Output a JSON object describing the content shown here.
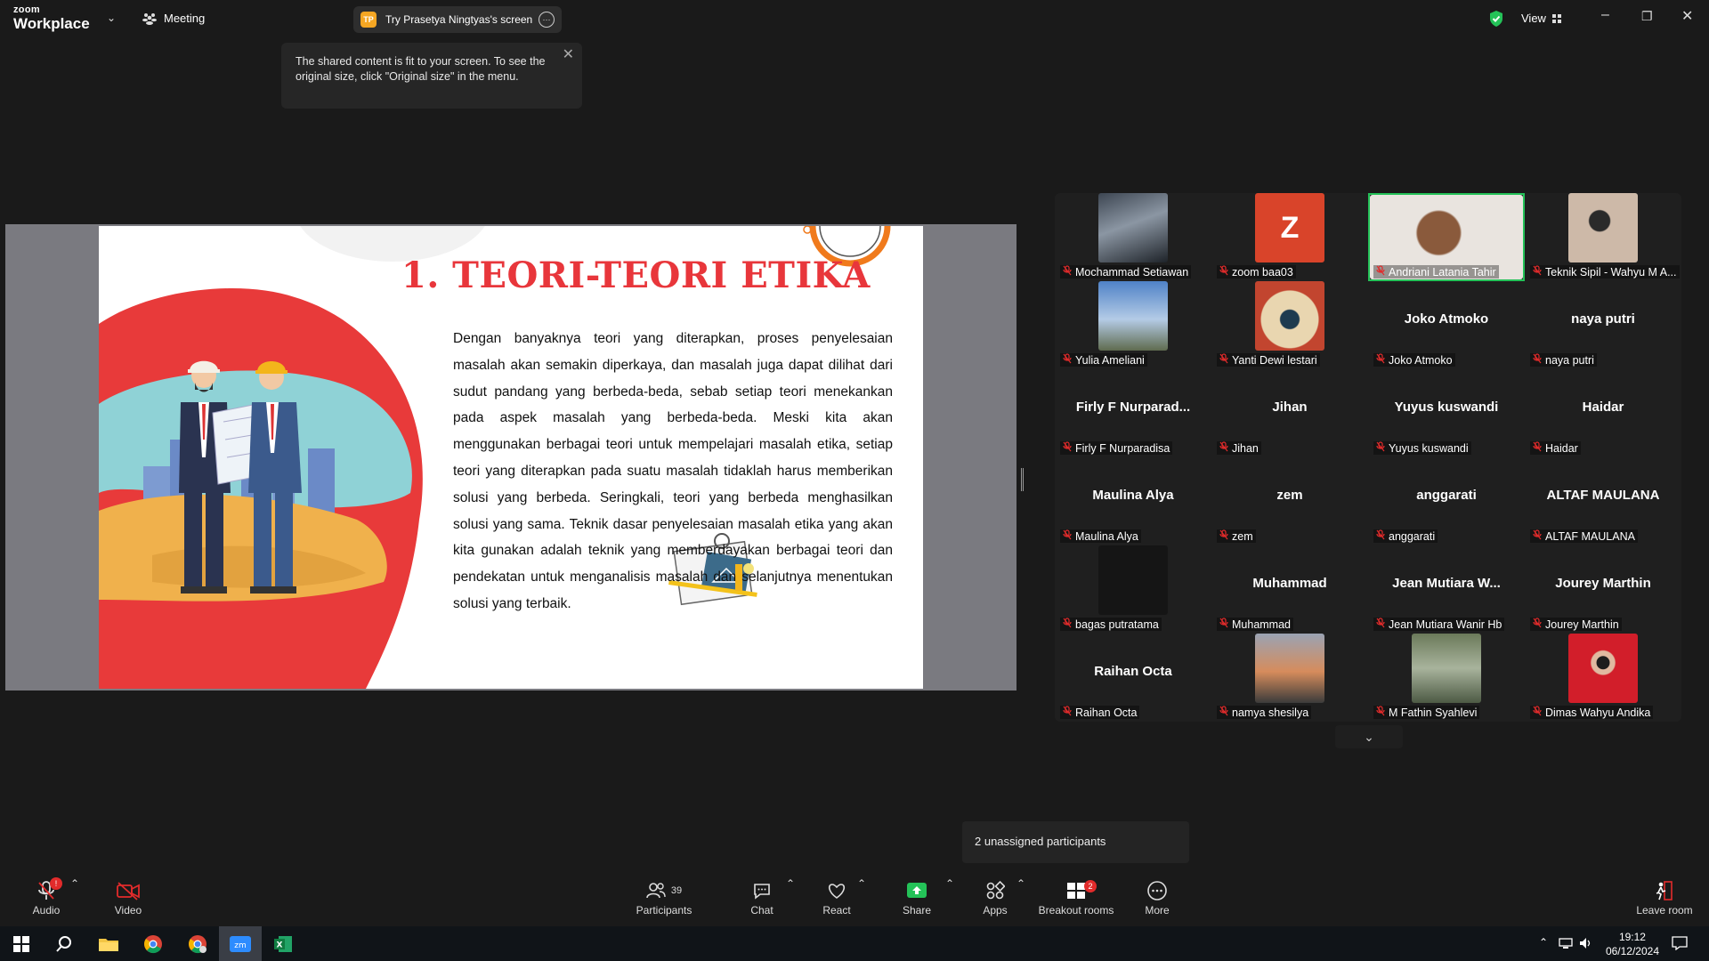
{
  "app": {
    "brand_small": "zoom",
    "brand_big": "Workplace",
    "meeting_label": "Meeting",
    "share_pill": "Try Prasetya Ningtyas's screen",
    "share_pill_initials": "TP",
    "view_label": "View"
  },
  "tooltip": {
    "text": "The shared content is fit to your screen. To see the original size, click \"Original size\" in the menu."
  },
  "slide": {
    "title": "1. TEORI-TEORI ETIKA",
    "body": "Dengan banyaknya teori yang diterapkan, proses penyelesaian masalah akan semakin diperkaya, dan masalah juga dapat dilihat dari sudut pandang yang berbeda-beda, sebab setiap teori menekankan pada aspek masalah yang berbeda-beda. Meski kita akan menggunakan berbagai teori untuk mempelajari masalah etika, setiap teori yang diterapkan pada suatu masalah tidaklah harus memberikan solusi yang berbeda. Seringkali, teori yang berbeda menghasilkan solusi yang sama. Teknik dasar penyelesaian masalah etika yang akan kita gunakan adalah teknik yang memberdayakan berbagai teori dan pendekatan untuk menganalisis masalah dan selanjutnya menentukan solusi yang terbaik."
  },
  "participants": [
    {
      "label": "Mochammad Setiawan",
      "big": "",
      "thumb": "photo-dark"
    },
    {
      "label": "zoom baa03",
      "big": "",
      "thumb": "z-letter",
      "letter": "Z"
    },
    {
      "label": "Andriani Latania Tahir",
      "big": "",
      "thumb": "photo-face",
      "active": true
    },
    {
      "label": "Teknik Sipil - Wahyu M A...",
      "big": "",
      "thumb": "photo-light"
    },
    {
      "label": "Yulia Ameliani",
      "big": "",
      "thumb": "photo-sky"
    },
    {
      "label": "Yanti Dewi lestari",
      "big": "",
      "thumb": "photo-food"
    },
    {
      "label": "Joko Atmoko",
      "big": "Joko Atmoko",
      "thumb": ""
    },
    {
      "label": "naya putri",
      "big": "naya putri",
      "thumb": ""
    },
    {
      "label": "Firly F Nurparadisa",
      "big": "Firly F Nurparad...",
      "thumb": ""
    },
    {
      "label": "Jihan",
      "big": "Jihan",
      "thumb": ""
    },
    {
      "label": "Yuyus kuswandi",
      "big": "Yuyus kuswandi",
      "thumb": ""
    },
    {
      "label": "Haidar",
      "big": "Haidar",
      "thumb": ""
    },
    {
      "label": "Maulina Alya",
      "big": "Maulina Alya",
      "thumb": ""
    },
    {
      "label": "zem",
      "big": "zem",
      "thumb": ""
    },
    {
      "label": "anggarati",
      "big": "anggarati",
      "thumb": ""
    },
    {
      "label": "ALTAF MAULANA",
      "big": "ALTAF MAULANA",
      "thumb": ""
    },
    {
      "label": "bagas putratama",
      "big": "",
      "thumb": "photo-black"
    },
    {
      "label": "Muhammad",
      "big": "Muhammad",
      "thumb": ""
    },
    {
      "label": "Jean Mutiara Wanir Hb",
      "big": "Jean Mutiara W...",
      "thumb": ""
    },
    {
      "label": "Jourey Marthin",
      "big": "Jourey Marthin",
      "thumb": ""
    },
    {
      "label": "Raihan Octa",
      "big": "Raihan Octa",
      "thumb": ""
    },
    {
      "label": "namya shesilya",
      "big": "",
      "thumb": "photo-sunset"
    },
    {
      "label": "M Fathin Syahlevi",
      "big": "",
      "thumb": "photo-street"
    },
    {
      "label": "Dimas Wahyu Andika",
      "big": "",
      "thumb": "photo-red"
    }
  ],
  "unassigned": "2 unassigned participants",
  "toolbar": {
    "audio": "Audio",
    "video": "Video",
    "participants": "Participants",
    "participants_count": "39",
    "chat": "Chat",
    "react": "React",
    "share": "Share",
    "apps": "Apps",
    "breakout": "Breakout rooms",
    "breakout_badge": "2",
    "more": "More",
    "leave": "Leave room"
  },
  "taskbar": {
    "time": "19:12",
    "date": "06/12/2024"
  },
  "colors": {
    "accent_green": "#24c258",
    "slide_red": "#e8363b",
    "mute_red": "#e22b2b"
  }
}
